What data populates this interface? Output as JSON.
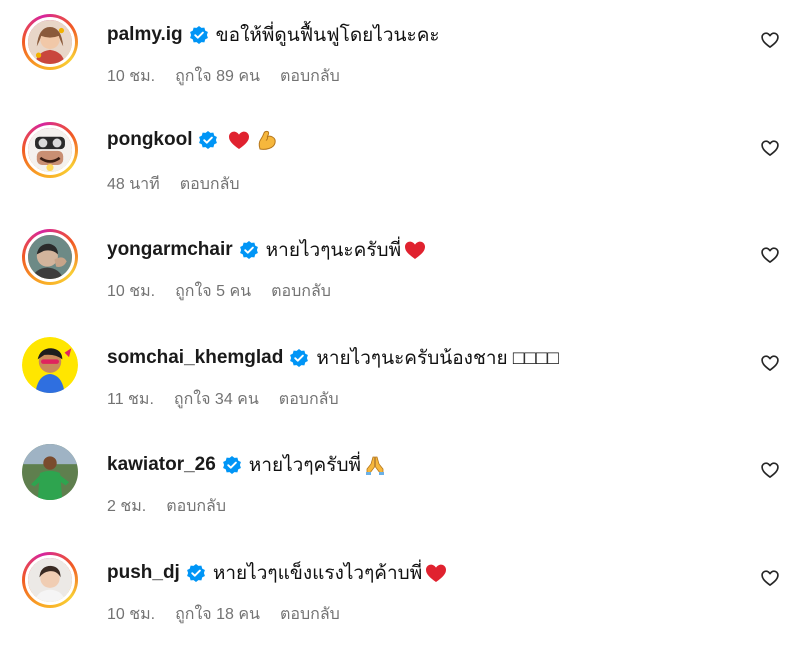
{
  "comments": [
    {
      "username": "palmy.ig",
      "text": "ขอให้พี่ดูนฟื้นฟูโดยไวนะคะ",
      "emoji": [],
      "time": "10 ชม.",
      "likes": "ถูกใจ 89 คน",
      "reply": "ตอบกลับ"
    },
    {
      "username": "pongkool",
      "text": "",
      "emoji": [
        "red-heart-emoji",
        "flexed-biceps-emoji"
      ],
      "time": "48 นาที",
      "likes": "",
      "reply": "ตอบกลับ"
    },
    {
      "username": "yongarmchair",
      "text": "หายไวๆนะครับพี่",
      "emoji": [
        "red-heart-emoji"
      ],
      "time": "10 ชม.",
      "likes": "ถูกใจ 5 คน",
      "reply": "ตอบกลับ"
    },
    {
      "username": "somchai_khemglad",
      "text": "หายไวๆนะครับน้องชาย □□□□",
      "emoji": [],
      "time": "11 ชม.",
      "likes": "ถูกใจ 34 คน",
      "reply": "ตอบกลับ"
    },
    {
      "username": "kawiator_26",
      "text": "หายไวๆครับพี่",
      "emoji": [
        "folded-hands-emoji"
      ],
      "time": "2 ชม.",
      "likes": "",
      "reply": "ตอบกลับ"
    },
    {
      "username": "push_dj",
      "text": "หายไวๆแข็งแรงไวๆค้าบพี่",
      "emoji": [
        "red-heart-emoji"
      ],
      "time": "10 ชม.",
      "likes": "ถูกใจ 18 คน",
      "reply": "ตอบกลับ"
    }
  ],
  "colors": {
    "verified_blue": "#0095f6",
    "meta_gray": "#737373",
    "ring_orange": "#f15a24",
    "ring_pink": "#d6249f",
    "ring_yellow": "#f9ce34"
  },
  "icons": {
    "verified": "verified-badge-icon",
    "like": "heart-outline-icon"
  }
}
